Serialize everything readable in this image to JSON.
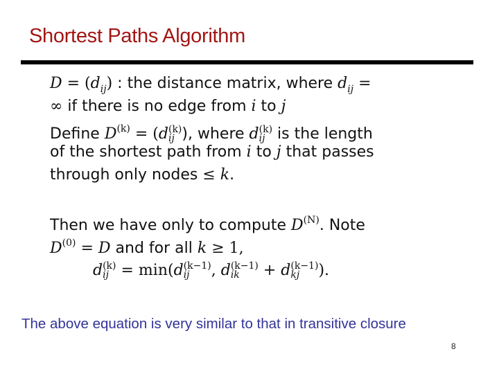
{
  "slide": {
    "title": "Shortest Paths Algorithm",
    "title_color": "#a31515",
    "page_number": "8"
  },
  "definitions": {
    "line1": {
      "lhs": "D",
      "eq": " = (",
      "d": "d",
      "sub": "ij",
      "close": ")",
      "text": " : the distance matrix, where ",
      "d2": "d",
      "sub2": "ij",
      "tail": " ="
    },
    "line2": {
      "infinity": "∞",
      "text1": " if there is no edge from ",
      "i": "i",
      "text2": " to ",
      "j": "j"
    },
    "line3": {
      "text1": "Define ",
      "D": "D",
      "sup": "(k)",
      "eq": " = (",
      "d": "d",
      "sup2": "(k)",
      "sub2": "ij",
      "text2": "), where ",
      "d3": "d",
      "sup3": "(k)",
      "sub3": "ij",
      "text3": " is the length"
    },
    "line4": {
      "text1": "of the shortest path from ",
      "i": "i",
      "text2": " to ",
      "j": "j",
      "text3": " that passes"
    },
    "line5": {
      "text1": "through only nodes ",
      "leq": "≤",
      "k": " k",
      "end": "."
    }
  },
  "recurrence": {
    "line1": {
      "text1": "Then we have only to compute ",
      "D": "D",
      "sup": "(N)",
      "text2": ".  Note"
    },
    "line2": {
      "D": "D",
      "sup": "(0)",
      "eq": " = ",
      "D2": "D",
      "text1": " and for all ",
      "k": "k",
      "geq": " ≥ 1,"
    },
    "equation": {
      "d": "d",
      "sup": "(k)",
      "sub": "ij",
      "eq": " = min(",
      "t1_d": "d",
      "t1_sup": "(k−1)",
      "t1_sub": "ij",
      "comma": ", ",
      "t2_d": "d",
      "t2_sup": "(k−1)",
      "t2_sub": "ik",
      "plus": " + ",
      "t3_d": "d",
      "t3_sup": "(k−1)",
      "t3_sub": "kj",
      "close": ")."
    }
  },
  "caption": {
    "text": "The above equation is very similar to that in transitive closure",
    "color": "#333399"
  }
}
